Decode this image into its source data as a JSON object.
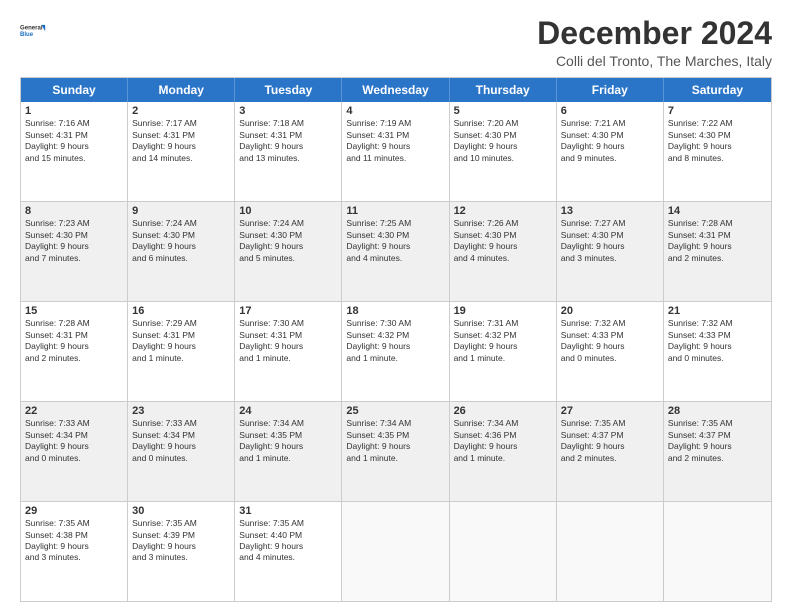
{
  "header": {
    "logo_line1": "General",
    "logo_line2": "Blue",
    "title": "December 2024",
    "subtitle": "Colli del Tronto, The Marches, Italy"
  },
  "weekdays": [
    "Sunday",
    "Monday",
    "Tuesday",
    "Wednesday",
    "Thursday",
    "Friday",
    "Saturday"
  ],
  "rows": [
    [
      {
        "day": "1",
        "info": "Sunrise: 7:16 AM\nSunset: 4:31 PM\nDaylight: 9 hours\nand 15 minutes.",
        "shaded": false
      },
      {
        "day": "2",
        "info": "Sunrise: 7:17 AM\nSunset: 4:31 PM\nDaylight: 9 hours\nand 14 minutes.",
        "shaded": false
      },
      {
        "day": "3",
        "info": "Sunrise: 7:18 AM\nSunset: 4:31 PM\nDaylight: 9 hours\nand 13 minutes.",
        "shaded": false
      },
      {
        "day": "4",
        "info": "Sunrise: 7:19 AM\nSunset: 4:31 PM\nDaylight: 9 hours\nand 11 minutes.",
        "shaded": false
      },
      {
        "day": "5",
        "info": "Sunrise: 7:20 AM\nSunset: 4:30 PM\nDaylight: 9 hours\nand 10 minutes.",
        "shaded": false
      },
      {
        "day": "6",
        "info": "Sunrise: 7:21 AM\nSunset: 4:30 PM\nDaylight: 9 hours\nand 9 minutes.",
        "shaded": false
      },
      {
        "day": "7",
        "info": "Sunrise: 7:22 AM\nSunset: 4:30 PM\nDaylight: 9 hours\nand 8 minutes.",
        "shaded": false
      }
    ],
    [
      {
        "day": "8",
        "info": "Sunrise: 7:23 AM\nSunset: 4:30 PM\nDaylight: 9 hours\nand 7 minutes.",
        "shaded": true
      },
      {
        "day": "9",
        "info": "Sunrise: 7:24 AM\nSunset: 4:30 PM\nDaylight: 9 hours\nand 6 minutes.",
        "shaded": true
      },
      {
        "day": "10",
        "info": "Sunrise: 7:24 AM\nSunset: 4:30 PM\nDaylight: 9 hours\nand 5 minutes.",
        "shaded": true
      },
      {
        "day": "11",
        "info": "Sunrise: 7:25 AM\nSunset: 4:30 PM\nDaylight: 9 hours\nand 4 minutes.",
        "shaded": true
      },
      {
        "day": "12",
        "info": "Sunrise: 7:26 AM\nSunset: 4:30 PM\nDaylight: 9 hours\nand 4 minutes.",
        "shaded": true
      },
      {
        "day": "13",
        "info": "Sunrise: 7:27 AM\nSunset: 4:30 PM\nDaylight: 9 hours\nand 3 minutes.",
        "shaded": true
      },
      {
        "day": "14",
        "info": "Sunrise: 7:28 AM\nSunset: 4:31 PM\nDaylight: 9 hours\nand 2 minutes.",
        "shaded": true
      }
    ],
    [
      {
        "day": "15",
        "info": "Sunrise: 7:28 AM\nSunset: 4:31 PM\nDaylight: 9 hours\nand 2 minutes.",
        "shaded": false
      },
      {
        "day": "16",
        "info": "Sunrise: 7:29 AM\nSunset: 4:31 PM\nDaylight: 9 hours\nand 1 minute.",
        "shaded": false
      },
      {
        "day": "17",
        "info": "Sunrise: 7:30 AM\nSunset: 4:31 PM\nDaylight: 9 hours\nand 1 minute.",
        "shaded": false
      },
      {
        "day": "18",
        "info": "Sunrise: 7:30 AM\nSunset: 4:32 PM\nDaylight: 9 hours\nand 1 minute.",
        "shaded": false
      },
      {
        "day": "19",
        "info": "Sunrise: 7:31 AM\nSunset: 4:32 PM\nDaylight: 9 hours\nand 1 minute.",
        "shaded": false
      },
      {
        "day": "20",
        "info": "Sunrise: 7:32 AM\nSunset: 4:33 PM\nDaylight: 9 hours\nand 0 minutes.",
        "shaded": false
      },
      {
        "day": "21",
        "info": "Sunrise: 7:32 AM\nSunset: 4:33 PM\nDaylight: 9 hours\nand 0 minutes.",
        "shaded": false
      }
    ],
    [
      {
        "day": "22",
        "info": "Sunrise: 7:33 AM\nSunset: 4:34 PM\nDaylight: 9 hours\nand 0 minutes.",
        "shaded": true
      },
      {
        "day": "23",
        "info": "Sunrise: 7:33 AM\nSunset: 4:34 PM\nDaylight: 9 hours\nand 0 minutes.",
        "shaded": true
      },
      {
        "day": "24",
        "info": "Sunrise: 7:34 AM\nSunset: 4:35 PM\nDaylight: 9 hours\nand 1 minute.",
        "shaded": true
      },
      {
        "day": "25",
        "info": "Sunrise: 7:34 AM\nSunset: 4:35 PM\nDaylight: 9 hours\nand 1 minute.",
        "shaded": true
      },
      {
        "day": "26",
        "info": "Sunrise: 7:34 AM\nSunset: 4:36 PM\nDaylight: 9 hours\nand 1 minute.",
        "shaded": true
      },
      {
        "day": "27",
        "info": "Sunrise: 7:35 AM\nSunset: 4:37 PM\nDaylight: 9 hours\nand 2 minutes.",
        "shaded": true
      },
      {
        "day": "28",
        "info": "Sunrise: 7:35 AM\nSunset: 4:37 PM\nDaylight: 9 hours\nand 2 minutes.",
        "shaded": true
      }
    ],
    [
      {
        "day": "29",
        "info": "Sunrise: 7:35 AM\nSunset: 4:38 PM\nDaylight: 9 hours\nand 3 minutes.",
        "shaded": false
      },
      {
        "day": "30",
        "info": "Sunrise: 7:35 AM\nSunset: 4:39 PM\nDaylight: 9 hours\nand 3 minutes.",
        "shaded": false
      },
      {
        "day": "31",
        "info": "Sunrise: 7:35 AM\nSunset: 4:40 PM\nDaylight: 9 hours\nand 4 minutes.",
        "shaded": false
      },
      {
        "day": "",
        "info": "",
        "shaded": false,
        "empty": true
      },
      {
        "day": "",
        "info": "",
        "shaded": false,
        "empty": true
      },
      {
        "day": "",
        "info": "",
        "shaded": false,
        "empty": true
      },
      {
        "day": "",
        "info": "",
        "shaded": false,
        "empty": true
      }
    ]
  ]
}
